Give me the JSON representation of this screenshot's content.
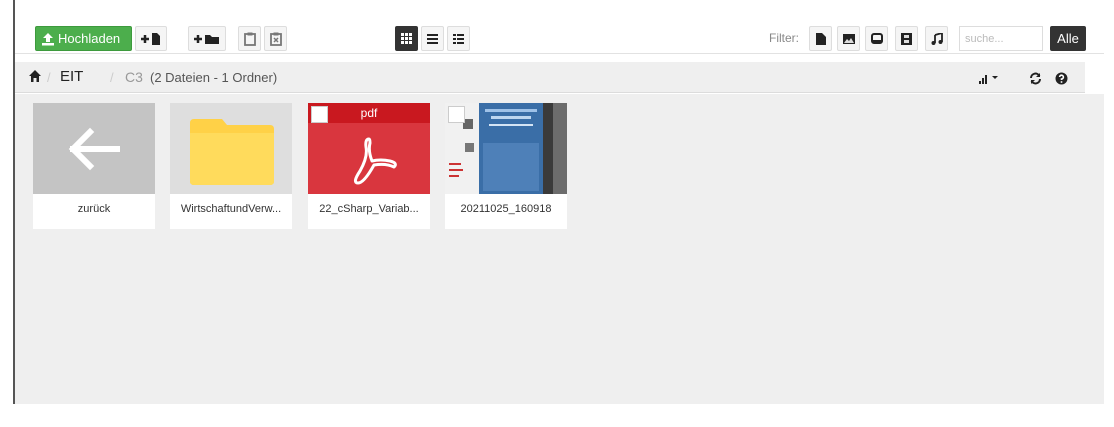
{
  "toolbar": {
    "upload_label": "Hochladen",
    "filter_label": "Filter:",
    "search_placeholder": "suche...",
    "all_label": "Alle"
  },
  "breadcrumb": {
    "crumbs": [
      "EIT",
      "C3"
    ],
    "count": "(2 Dateien - 1 Ordner)"
  },
  "items": [
    {
      "label": "zurück",
      "kind": "back"
    },
    {
      "label": "WirtschaftundVerw...",
      "kind": "folder"
    },
    {
      "label": "22_cSharp_Variab...",
      "kind": "pdf",
      "badge": "pdf"
    },
    {
      "label": "20211025_160918",
      "kind": "image"
    }
  ],
  "colors": {
    "upload_green": "#4cae4c",
    "pdf_red": "#d9363e",
    "folder_yellow": "#ffd147",
    "back_gray": "#c4c4c4"
  }
}
